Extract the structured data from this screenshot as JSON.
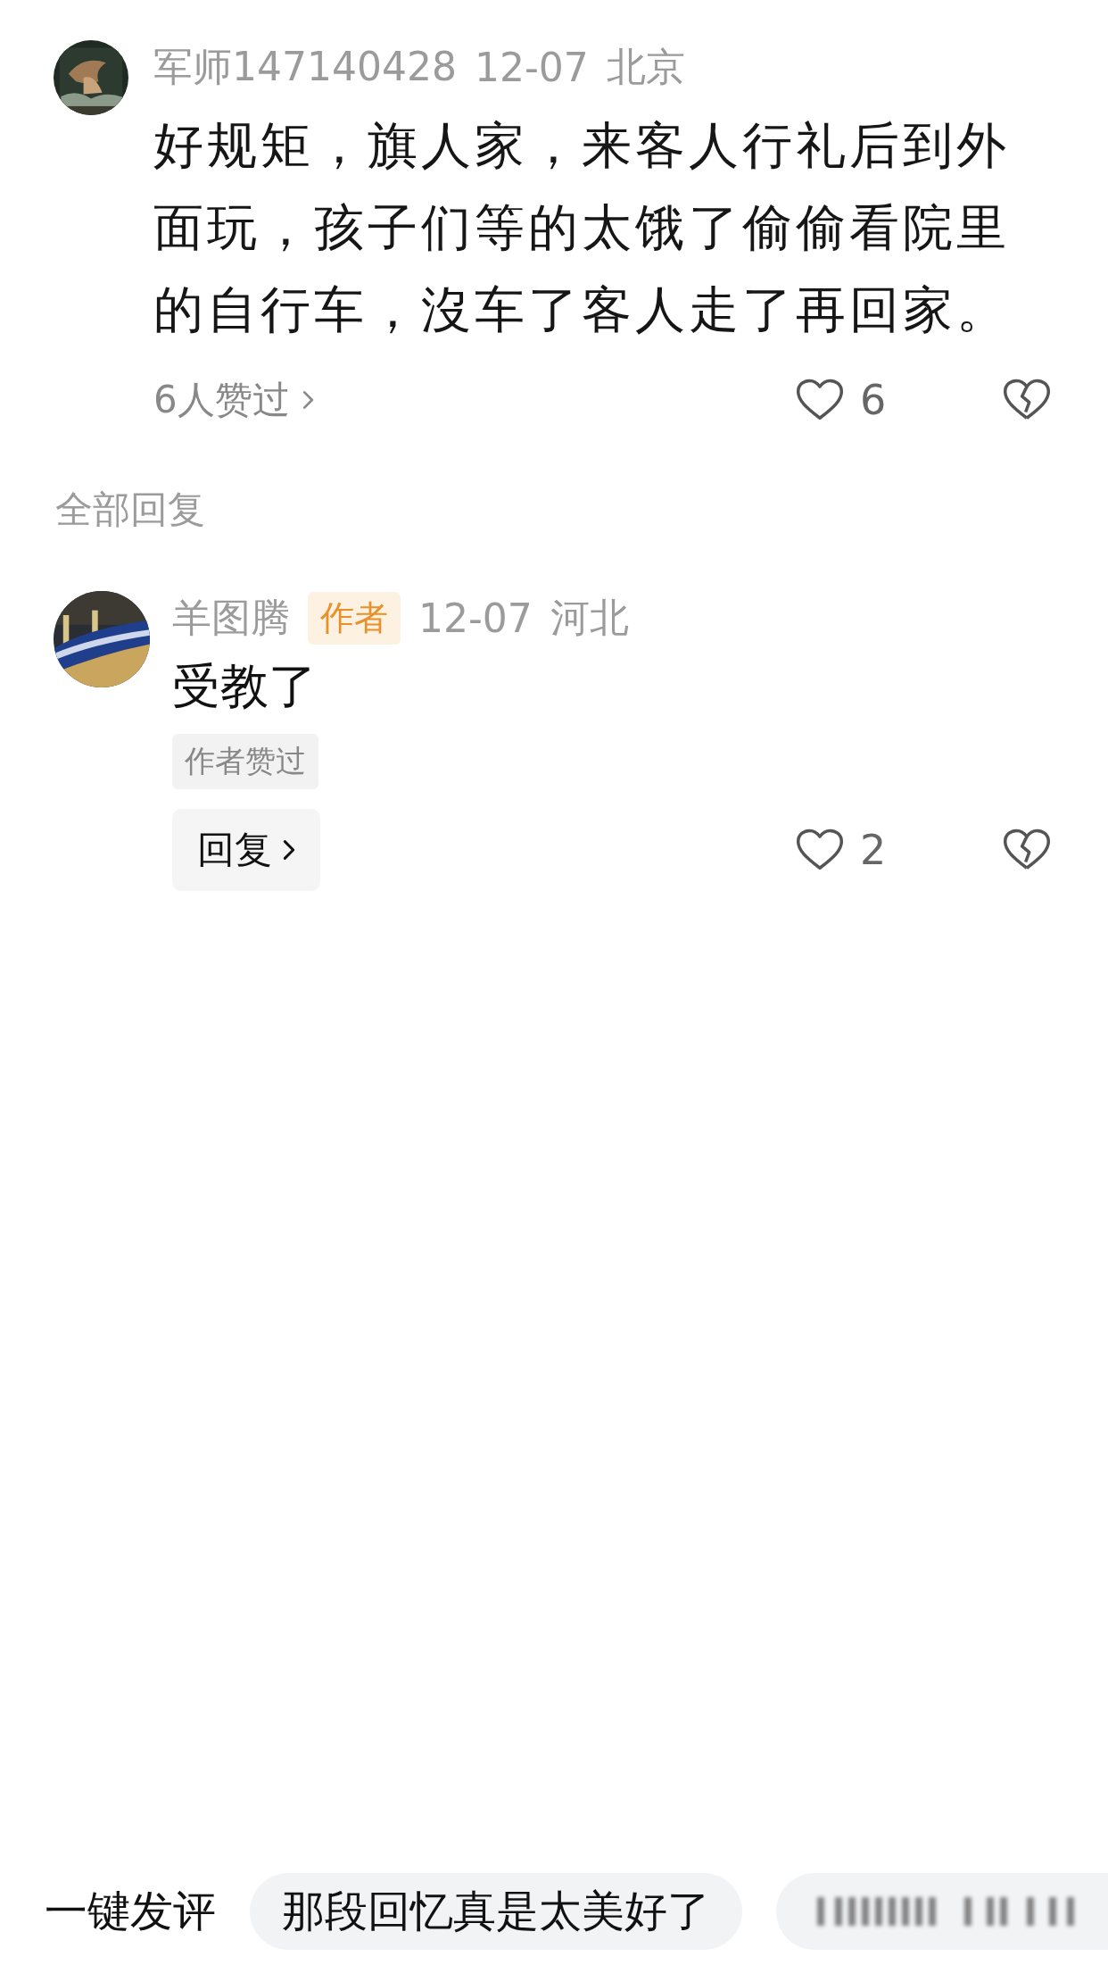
{
  "comment": {
    "author": "军师147140428",
    "date": "12-07",
    "location": "北京",
    "text": "好规矩，旗人家，来客人行礼后到外面玩，孩子们等的太饿了偷偷看院里的自行车，沒车了客人走了再回家。",
    "likes_summary": "6人赞过",
    "like_count": "6"
  },
  "section_title": "全部回复",
  "replies": [
    {
      "author": "羊图腾",
      "badge": "作者",
      "date": "12-07",
      "location": "河北",
      "text": "受教了",
      "author_liked": "作者赞过",
      "reply_button": "回复",
      "like_count": "2"
    }
  ],
  "quick_comment": {
    "label": "一键发评",
    "suggestions": [
      {
        "kind": "text",
        "text": "那段回忆真是太美好了"
      },
      {
        "kind": "blurred"
      }
    ]
  }
}
